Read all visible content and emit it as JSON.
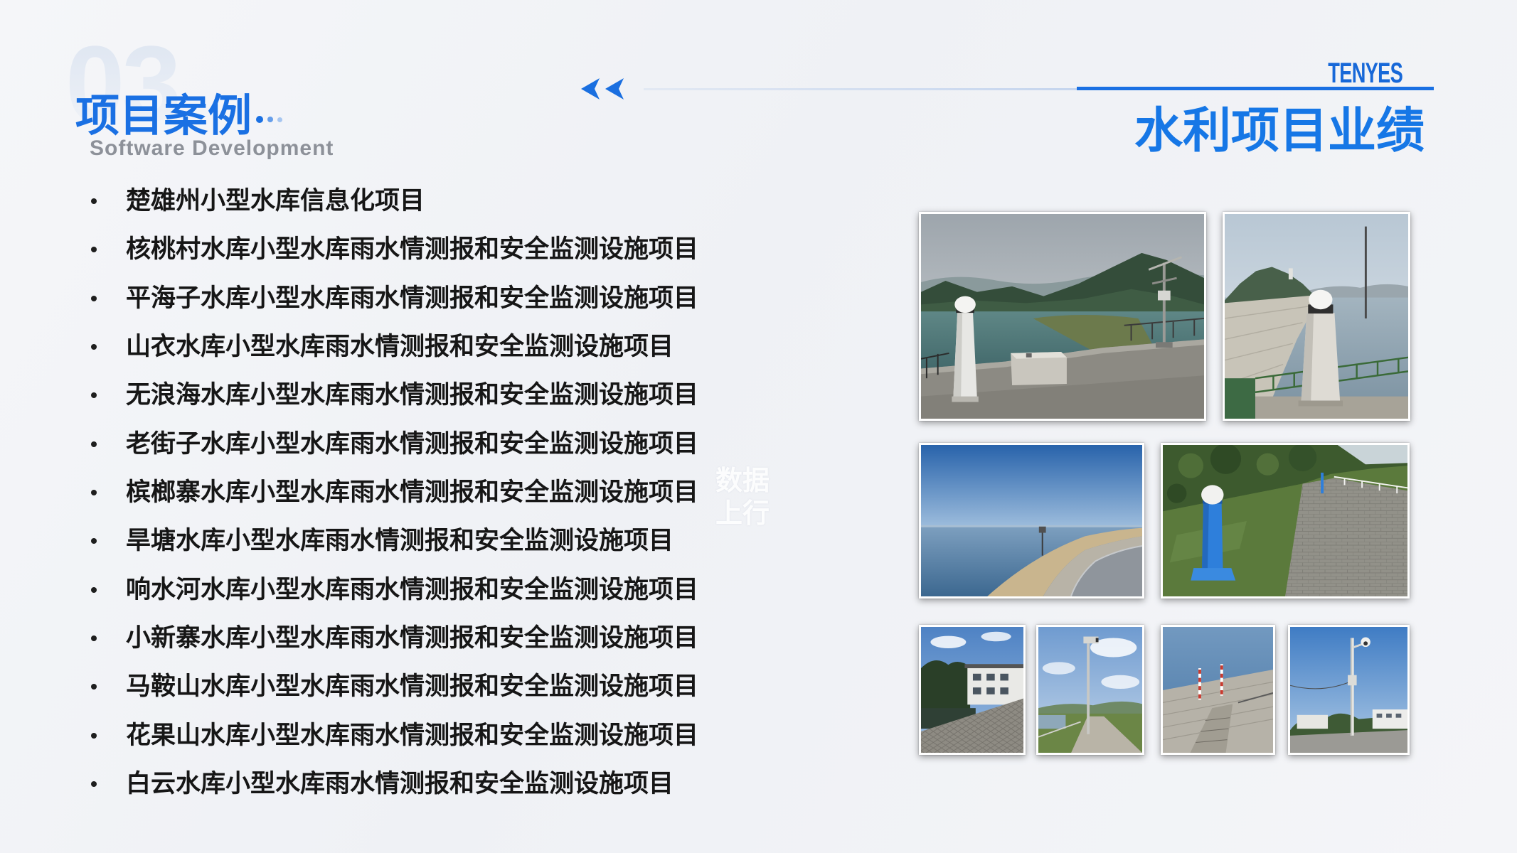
{
  "background_number": "03",
  "header": {
    "section_title": "项目案例",
    "section_subtitle": "Software Development",
    "brand": "TENYES",
    "page_title": "水利项目业绩"
  },
  "projects": [
    "楚雄州小型水库信息化项目",
    "核桃村水库小型水库雨水情测报和安全监测设施项目",
    "平海子水库小型水库雨水情测报和安全监测设施项目",
    "山衣水库小型水库雨水情测报和安全监测设施项目",
    "无浪海水库小型水库雨水情测报和安全监测设施项目",
    "老街子水库小型水库雨水情测报和安全监测设施项目",
    "槟榔寨水库小型水库雨水情测报和安全监测设施项目",
    "旱塘水库小型水库雨水情测报和安全监测设施项目",
    "响水河水库小型水库雨水情测报和安全监测设施项目",
    "小新寨水库小型水库雨水情测报和安全监测设施项目",
    "马鞍山水库小型水库雨水情测报和安全监测设施项目",
    "花果山水库小型水库雨水情测报和安全监测设施项目",
    "白云水库小型水库雨水情测报和安全监测设施项目"
  ],
  "overlay_watermark": {
    "line1": "数据",
    "line2": "上行"
  },
  "icons": {
    "title_decoration": "dots-icon",
    "navigation": "double-chevron-left-icon",
    "list_marker": "bullet-icon"
  },
  "colors": {
    "accent": "#1677e6",
    "text": "#161616",
    "muted": "#8d9199",
    "line": "#c9d8ee",
    "background": "#f3f4f7"
  }
}
